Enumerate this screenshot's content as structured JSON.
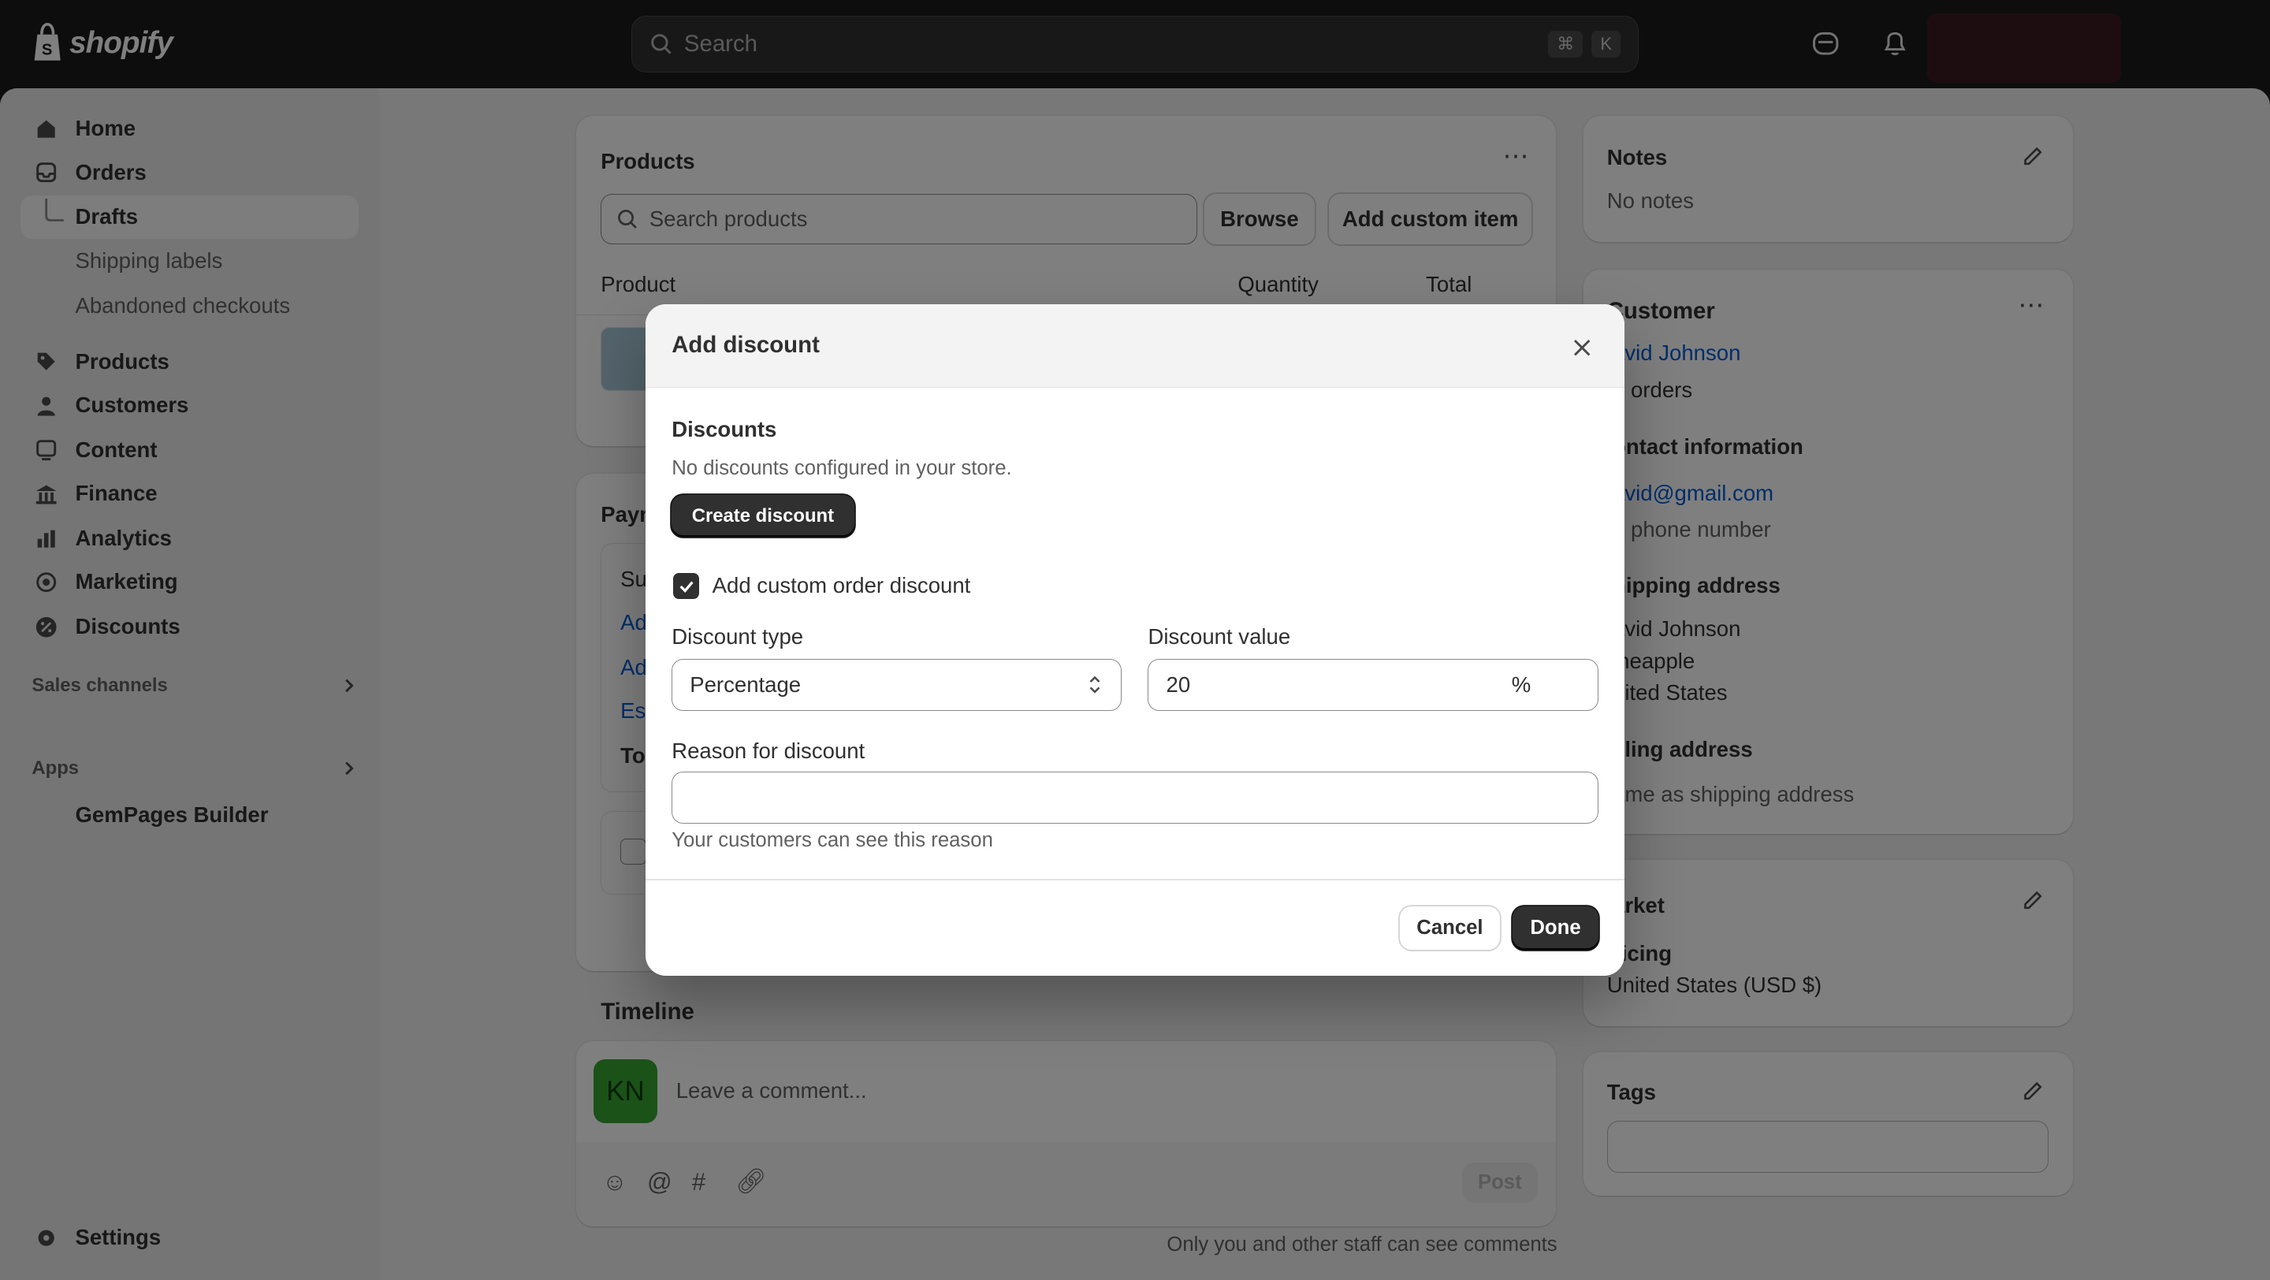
{
  "topbar": {
    "logo_text": "shopify",
    "search_placeholder": "Search",
    "shortcut_keys": [
      "⌘",
      "K"
    ]
  },
  "sidebar": {
    "items": [
      {
        "label": "Home"
      },
      {
        "label": "Orders"
      },
      {
        "label": "Drafts"
      },
      {
        "label": "Shipping labels"
      },
      {
        "label": "Abandoned checkouts"
      },
      {
        "label": "Products"
      },
      {
        "label": "Customers"
      },
      {
        "label": "Content"
      },
      {
        "label": "Finance"
      },
      {
        "label": "Analytics"
      },
      {
        "label": "Marketing"
      },
      {
        "label": "Discounts"
      }
    ],
    "sales_channels": "Sales channels",
    "apps": "Apps",
    "app_items": [
      {
        "label": "GemPages Builder"
      }
    ],
    "settings": "Settings"
  },
  "products_card": {
    "title": "Products",
    "search_placeholder": "Search products",
    "browse": "Browse",
    "add_custom_item": "Add custom item",
    "col_product": "Product",
    "col_quantity": "Quantity",
    "col_total": "Total"
  },
  "payment_card": {
    "title_partial": "Paym",
    "rows": [
      "Su",
      "Ad",
      "Ad",
      "Es",
      "To"
    ]
  },
  "timeline": {
    "title": "Timeline",
    "avatar_initials": "KN",
    "comment_placeholder": "Leave a comment...",
    "post": "Post",
    "note": "Only you and other staff can see comments"
  },
  "notes_card": {
    "title": "Notes",
    "value": "No notes"
  },
  "customer_card": {
    "title": "Customer",
    "name": "avid Johnson",
    "orders": "o orders",
    "contact_title": "ontact information",
    "email": "avid@gmail.com",
    "phone": "o phone number",
    "shipping_title": "hipping address",
    "shipping_lines": [
      "avid Johnson",
      "ineapple",
      "nited States"
    ],
    "billing_title": "illing address",
    "billing_value": "ame as shipping address"
  },
  "market_card": {
    "title": "arket",
    "pricing_label": "ricing",
    "pricing_value": "United States (USD $)"
  },
  "tags_card": {
    "title": "Tags"
  },
  "modal": {
    "title": "Add discount",
    "discounts_heading": "Discounts",
    "no_discounts": "No discounts configured in your store.",
    "create_discount": "Create discount",
    "custom_discount_label": "Add custom order discount",
    "custom_discount_checked": true,
    "discount_type_label": "Discount type",
    "discount_type_value": "Percentage",
    "discount_value_label": "Discount value",
    "discount_value": "20",
    "discount_suffix": "%",
    "reason_label": "Reason for discount",
    "reason_value": "",
    "reason_help": "Your customers can see this reason",
    "cancel": "Cancel",
    "done": "Done"
  }
}
